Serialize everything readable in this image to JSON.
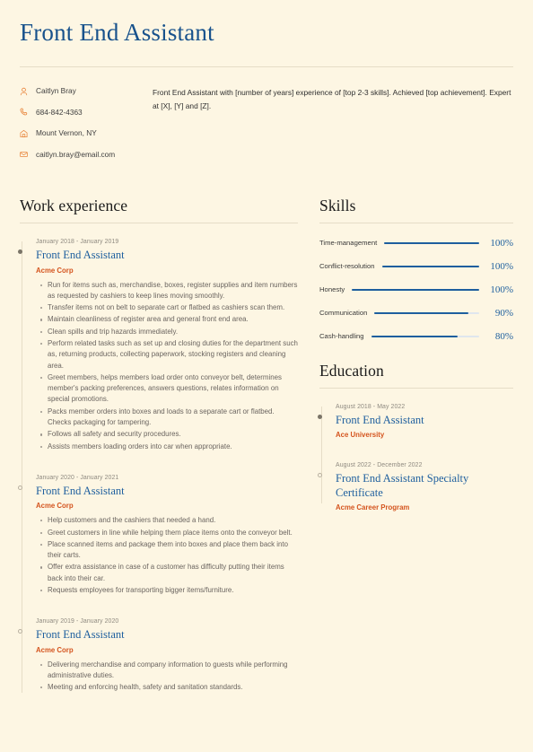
{
  "header": {
    "title": "Front End Assistant",
    "colors": {
      "page_background": "#fdf6e3",
      "title_blue": "#18528c",
      "accent_orange": "#d4541e",
      "icon_orange": "#e8853c",
      "link_blue": "#1e5f9e",
      "rule": "#e6ddc7"
    }
  },
  "contact": {
    "items": [
      {
        "icon": "person-icon",
        "text": "Caitlyn Bray"
      },
      {
        "icon": "phone-icon",
        "text": "684-842-4363"
      },
      {
        "icon": "location-icon",
        "text": "Mount Vernon, NY"
      },
      {
        "icon": "email-icon",
        "text": "caitlyn.bray@email.com"
      }
    ]
  },
  "summary": {
    "text": "Front End Assistant with [number of years] experience of [top 2-3 skills]. Achieved [top achievement]. Expert at [X], [Y] and [Z]."
  },
  "work_experience": {
    "heading": "Work experience",
    "entries": [
      {
        "date": "January 2018 - January 2019",
        "role": "Front End Assistant",
        "organization": "Acme Corp",
        "marker": "filled",
        "bullets": [
          "Run for items such as, merchandise, boxes, register supplies and item numbers as requested by cashiers to keep lines moving smoothly.",
          "Transfer items not on belt to separate cart or flatbed as cashiers scan them.",
          "Maintain cleanliness of register area and general front end area.",
          "Clean spills and trip hazards immediately.",
          "Perform related tasks such as set up and closing duties for the department such as, returning products, collecting paperwork, stocking registers and cleaning area.",
          "Greet members, helps members load order onto conveyor belt, determines member's packing preferences, answers questions, relates information on special promotions.",
          "Packs member orders into boxes and loads to a separate cart or flatbed. Checks packaging for tampering.",
          "Follows all safety and security procedures.",
          "Assists members loading orders into car when appropriate."
        ]
      },
      {
        "date": "January 2020 - January 2021",
        "role": "Front End Assistant",
        "organization": "Acme Corp",
        "marker": "hollow",
        "bullets": [
          "Help customers and the cashiers that needed a hand.",
          "Greet customers in line while helping them place items onto the conveyor belt.",
          "Place scanned items and package them into boxes and place them back into their carts.",
          "Offer extra assistance in case of a customer has difficulty putting their items back into their car.",
          "Requests employees for transporting bigger items/furniture."
        ]
      },
      {
        "date": "January 2019 - January 2020",
        "role": "Front End Assistant",
        "organization": "Acme Corp",
        "marker": "hollow",
        "bullets": [
          "Delivering merchandise and company information to guests while performing administrative duties.",
          "Meeting and enforcing health, safety and sanitation standards."
        ]
      }
    ]
  },
  "skills": {
    "heading": "Skills",
    "items": [
      {
        "name": "Time-management",
        "percent_label": "100%",
        "percent": 100
      },
      {
        "name": "Conflict-resolution",
        "percent_label": "100%",
        "percent": 100
      },
      {
        "name": "Honesty",
        "percent_label": "100%",
        "percent": 100
      },
      {
        "name": "Communication",
        "percent_label": "90%",
        "percent": 90
      },
      {
        "name": "Cash-handling",
        "percent_label": "80%",
        "percent": 80
      }
    ]
  },
  "education": {
    "heading": "Education",
    "entries": [
      {
        "date": "August 2018 - May 2022",
        "role": "Front End Assistant",
        "organization": "Ace University",
        "marker": "filled"
      },
      {
        "date": "August 2022 - December 2022",
        "role": "Front End Assistant Specialty Certificate",
        "organization": "Acme Career Program",
        "marker": "hollow"
      }
    ]
  }
}
